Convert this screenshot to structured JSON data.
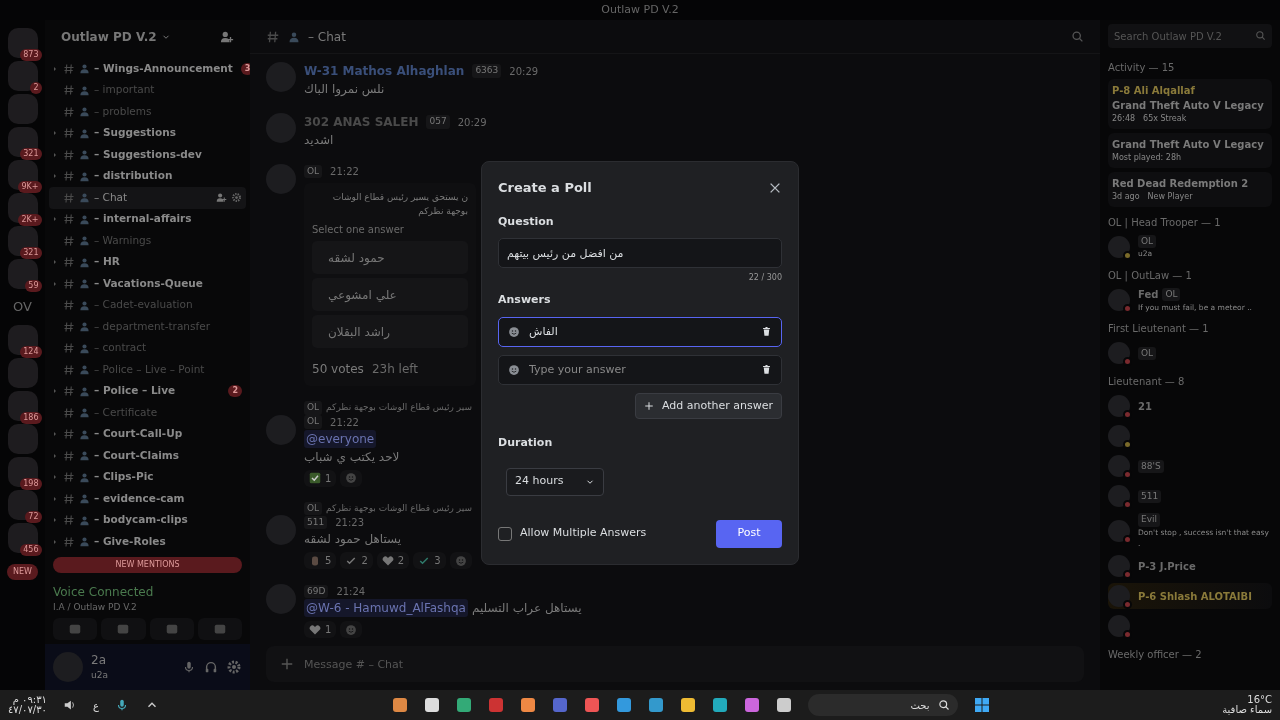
{
  "title_bar": {
    "title": "Outlaw PD V.2"
  },
  "servers": [
    {
      "kind": "image",
      "badge": "873"
    },
    {
      "kind": "image",
      "badge": "2"
    },
    {
      "kind": "image"
    },
    {
      "kind": "image",
      "badge": "321"
    },
    {
      "kind": "image",
      "badge": "9K+"
    },
    {
      "kind": "image",
      "badge": "2K+"
    },
    {
      "kind": "image",
      "badge": "321"
    },
    {
      "kind": "image",
      "badge": "59"
    },
    {
      "kind": "text",
      "label": "OV"
    },
    {
      "kind": "image",
      "badge": "124"
    },
    {
      "kind": "image"
    },
    {
      "kind": "image",
      "badge": "186"
    },
    {
      "kind": "image"
    },
    {
      "kind": "image",
      "badge": "198"
    },
    {
      "kind": "image",
      "badge": "72"
    },
    {
      "kind": "image",
      "badge": "456"
    }
  ],
  "new_pill": "NEW",
  "server_name": "Outlaw PD V.2",
  "channels": [
    {
      "name": "– Wings-Announcement",
      "unread": true,
      "selected": false,
      "badge": "3"
    },
    {
      "name": "– important",
      "unread": false,
      "selected": false
    },
    {
      "name": "– problems",
      "unread": false,
      "selected": false
    },
    {
      "name": "– Suggestions",
      "unread": true,
      "selected": false
    },
    {
      "name": "– Suggestions-dev",
      "unread": true,
      "selected": false
    },
    {
      "name": "– distribution",
      "unread": true,
      "selected": false
    },
    {
      "name": "– Chat",
      "unread": false,
      "selected": true
    },
    {
      "name": "– internal-affairs",
      "unread": true,
      "selected": false
    },
    {
      "name": "– Warnings",
      "unread": false,
      "selected": false
    },
    {
      "name": "– HR",
      "unread": true,
      "selected": false
    },
    {
      "name": "– Vacations-Queue",
      "unread": true,
      "selected": false
    },
    {
      "name": "– Cadet-evaluation",
      "unread": false,
      "selected": false
    },
    {
      "name": "– department-transfer",
      "unread": false,
      "selected": false
    },
    {
      "name": "– contract",
      "unread": false,
      "selected": false
    },
    {
      "name": "– Police – Live – Point",
      "unread": false,
      "selected": false
    },
    {
      "name": "– Police – Live",
      "unread": true,
      "selected": false,
      "badge": "2"
    },
    {
      "name": "– Certificate",
      "unread": false,
      "selected": false
    },
    {
      "name": "– Court-Call-Up",
      "unread": true,
      "selected": false
    },
    {
      "name": "– Court-Claims",
      "unread": true,
      "selected": false
    },
    {
      "name": "– Clips-Pic",
      "unread": true,
      "selected": false
    },
    {
      "name": "– evidence-cam",
      "unread": true,
      "selected": false
    },
    {
      "name": "– bodycam-clips",
      "unread": true,
      "selected": false
    },
    {
      "name": "– Give-Roles",
      "unread": true,
      "selected": false
    }
  ],
  "new_mentions": "NEW MENTIONS",
  "voice": {
    "status": "Voice Connected",
    "channel": "I.A / Outlaw PD V.2"
  },
  "user": {
    "name": "2a",
    "status": "u2a"
  },
  "chat": {
    "channel": "– Chat",
    "composer_placeholder": "Message # – Chat",
    "messages": [
      {
        "author": "W-31 Mathos Alhaghlan",
        "color": "#3a4f7a",
        "tag": "6363",
        "time": "20:29",
        "text": "نلس نمروا الباك"
      },
      {
        "author": "302 ANAS SALEH",
        "color": "#4a4a4a",
        "tag": "057",
        "time": "20:29",
        "text": "اشديد"
      },
      {
        "tag": "OL",
        "time": "21:22",
        "poll": {
          "question": "ن يستحق يسير رئيس قطاع الوشات بوجهة نظركم",
          "hint": "Select one answer",
          "options": [
            "حمود لشقه",
            "علي امشوعي",
            "راشد البقلان"
          ],
          "votes": "50 votes",
          "left": "23h left"
        }
      },
      {
        "reply": {
          "tag": "OL",
          "text": "سير رئيس قطاع الوشات بوجهة نظركم"
        },
        "tag": "OL",
        "time": "21:22",
        "mention": "@everyone",
        "text": "لاحد يكتب ي شباب",
        "reactions": [
          {
            "kind": "check-box",
            "count": "1"
          }
        ]
      },
      {
        "reply": {
          "tag": "OL",
          "text": "سير رئيس قطاع الوشات بوجهة نظركم"
        },
        "tag": "511",
        "time": "21:23",
        "text": "يستاهل حمود لشقه",
        "reactions": [
          {
            "kind": "figure",
            "count": "5"
          },
          {
            "kind": "check",
            "count": "2"
          },
          {
            "kind": "heart",
            "count": "2"
          },
          {
            "kind": "check-teal",
            "count": "3"
          }
        ]
      },
      {
        "tag": "69D",
        "time": "21:24",
        "mention": "@W-6 - Hamuwd_AlFashqa",
        "text": "يستاهل عراب التسليم",
        "reactions": [
          {
            "kind": "heart",
            "count": "1"
          }
        ]
      }
    ]
  },
  "members": {
    "search_placeholder": "Search Outlaw PD V.2",
    "activity_title": "Activity — 15",
    "activities": [
      {
        "user": "P-8 Ali Alqallaf",
        "game": "Grand Theft Auto V Legacy",
        "details": [
          "26:48",
          "65x Streak"
        ]
      },
      {
        "game": "Grand Theft Auto V Legacy",
        "details": [
          "Most played: 28h"
        ]
      },
      {
        "game": "Red Dead Redemption 2",
        "details": [
          "3d ago",
          "New Player"
        ]
      }
    ],
    "groups": [
      {
        "title": "OL | Head Trooper — 1",
        "members": [
          {
            "color": "#7a6a2a",
            "tag": "OL",
            "status": "u2a"
          }
        ]
      },
      {
        "title": "OL | OutLaw — 1",
        "members": [
          {
            "color": "#7a2a2e",
            "name": "Fed",
            "tag": "OL",
            "status": "If you must fail, be a meteor .."
          }
        ]
      },
      {
        "title": "First Lieutenant — 1",
        "members": [
          {
            "color": "#7a2a2e",
            "tag": "OL"
          }
        ]
      },
      {
        "title": "Lieutenant — 8",
        "members": [
          {
            "color": "#7a2a2e",
            "name": "21"
          },
          {
            "color": "#7a6a2a"
          },
          {
            "color": "#7a2a2e",
            "tag": "88'S"
          },
          {
            "color": "#7a2a2e",
            "tag": "511"
          },
          {
            "color": "#7a2a2e",
            "tag": "Evil",
            "status": "Don't stop , success isn't that easy ."
          },
          {
            "color": "#7a2a2e",
            "name": "P-3 J.Price"
          },
          {
            "color": "#7a2a2e",
            "name": "P-6 Shlash ALOTAIBI",
            "highlighted": true
          },
          {
            "color": "#7a2a2e"
          }
        ]
      },
      {
        "title": "Weekly officer — 2"
      }
    ]
  },
  "poll_dialog": {
    "title": "Create a Poll",
    "question_label": "Question",
    "question": "من افضل من رئيس بيتهم",
    "counter": "22 / 300",
    "answers_label": "Answers",
    "answers": [
      {
        "value": "الفاش",
        "focused": true
      },
      {
        "placeholder": "Type your answer",
        "focused": false
      }
    ],
    "add_answer": "Add another answer",
    "duration_label": "Duration",
    "duration": "24 hours",
    "multiple_label": "Allow Multiple Answers",
    "multiple": false,
    "post": "Post"
  },
  "taskbar": {
    "time": "٠٩:٣١ م",
    "date": "٤٧/٠٧/٣٠",
    "language": "ع",
    "search": "بحث",
    "temperature": "16°C",
    "weather": "سماء صافية"
  }
}
